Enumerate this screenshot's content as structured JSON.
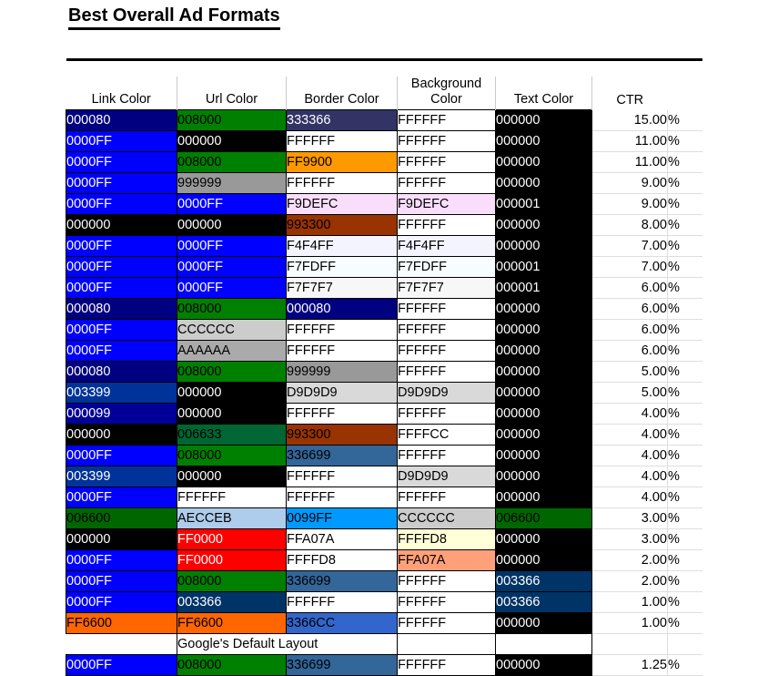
{
  "page": {
    "title": "Best Overall Ad Formats"
  },
  "table": {
    "columns": [
      {
        "key": "link",
        "label": "Link Color"
      },
      {
        "key": "url",
        "label": "Url Color"
      },
      {
        "key": "border",
        "label": "Border Color"
      },
      {
        "key": "bg",
        "label": "Background Color",
        "label_line1": "Background",
        "label_line2": "Color"
      },
      {
        "key": "text",
        "label": "Text Color"
      },
      {
        "key": "ctr",
        "label": "CTR"
      },
      {
        "key": "pct",
        "label": ""
      }
    ],
    "percent_symbol": "%",
    "note_row_label": "Google's Default Layout",
    "rows": [
      {
        "link": "000080",
        "link_bg": "#000080",
        "link_fg": "#ffffff",
        "url": "008000",
        "url_bg": "#008000",
        "url_fg": "#000000",
        "border": "333366",
        "border_bg": "#333366",
        "border_fg": "#ffffff",
        "bg": "FFFFFF",
        "bg_bg": "#ffffff",
        "bg_fg": "#000000",
        "text": "000000",
        "text_bg": "#000000",
        "text_fg": "#ffffff",
        "ctr": "15.00"
      },
      {
        "link": "0000FF",
        "link_bg": "#0000ff",
        "link_fg": "#ffffff",
        "url": "000000",
        "url_bg": "#000000",
        "url_fg": "#ffffff",
        "border": "FFFFFF",
        "border_bg": "#ffffff",
        "border_fg": "#000000",
        "bg": "FFFFFF",
        "bg_bg": "#ffffff",
        "bg_fg": "#000000",
        "text": "000000",
        "text_bg": "#000000",
        "text_fg": "#ffffff",
        "ctr": "11.00"
      },
      {
        "link": "0000FF",
        "link_bg": "#0000ff",
        "link_fg": "#ffffff",
        "url": "008000",
        "url_bg": "#008000",
        "url_fg": "#000000",
        "border": "FF9900",
        "border_bg": "#ff9900",
        "border_fg": "#000000",
        "bg": "FFFFFF",
        "bg_bg": "#ffffff",
        "bg_fg": "#000000",
        "text": "000000",
        "text_bg": "#000000",
        "text_fg": "#ffffff",
        "ctr": "11.00"
      },
      {
        "link": "0000FF",
        "link_bg": "#0000ff",
        "link_fg": "#ffffff",
        "url": "999999",
        "url_bg": "#999999",
        "url_fg": "#000000",
        "border": "FFFFFF",
        "border_bg": "#ffffff",
        "border_fg": "#000000",
        "bg": "FFFFFF",
        "bg_bg": "#ffffff",
        "bg_fg": "#000000",
        "text": "000000",
        "text_bg": "#000000",
        "text_fg": "#ffffff",
        "ctr": "9.00"
      },
      {
        "link": "0000FF",
        "link_bg": "#0000ff",
        "link_fg": "#ffffff",
        "url": "0000FF",
        "url_bg": "#0000ff",
        "url_fg": "#ffffff",
        "border": "F9DEFC",
        "border_bg": "#f9defc",
        "border_fg": "#000000",
        "bg": "F9DEFC",
        "bg_bg": "#f9defc",
        "bg_fg": "#000000",
        "text": "000001",
        "text_bg": "#000001",
        "text_fg": "#ffffff",
        "ctr": "9.00"
      },
      {
        "link": "000000",
        "link_bg": "#000000",
        "link_fg": "#ffffff",
        "url": "000000",
        "url_bg": "#000000",
        "url_fg": "#ffffff",
        "border": "993300",
        "border_bg": "#993300",
        "border_fg": "#000000",
        "bg": "FFFFFF",
        "bg_bg": "#ffffff",
        "bg_fg": "#000000",
        "text": "000000",
        "text_bg": "#000000",
        "text_fg": "#ffffff",
        "ctr": "8.00"
      },
      {
        "link": "0000FF",
        "link_bg": "#0000ff",
        "link_fg": "#ffffff",
        "url": "0000FF",
        "url_bg": "#0000ff",
        "url_fg": "#ffffff",
        "border": "F4F4FF",
        "border_bg": "#f4f4ff",
        "border_fg": "#000000",
        "bg": "F4F4FF",
        "bg_bg": "#f4f4ff",
        "bg_fg": "#000000",
        "text": "000000",
        "text_bg": "#000000",
        "text_fg": "#ffffff",
        "ctr": "7.00"
      },
      {
        "link": "0000FF",
        "link_bg": "#0000ff",
        "link_fg": "#ffffff",
        "url": "0000FF",
        "url_bg": "#0000ff",
        "url_fg": "#ffffff",
        "border": "F7FDFF",
        "border_bg": "#f7fdff",
        "border_fg": "#000000",
        "bg": "F7FDFF",
        "bg_bg": "#f7fdff",
        "bg_fg": "#000000",
        "text": "000001",
        "text_bg": "#000001",
        "text_fg": "#ffffff",
        "ctr": "7.00"
      },
      {
        "link": "0000FF",
        "link_bg": "#0000ff",
        "link_fg": "#ffffff",
        "url": "0000FF",
        "url_bg": "#0000ff",
        "url_fg": "#ffffff",
        "border": "F7F7F7",
        "border_bg": "#f7f7f7",
        "border_fg": "#000000",
        "bg": "F7F7F7",
        "bg_bg": "#f7f7f7",
        "bg_fg": "#000000",
        "text": "000001",
        "text_bg": "#000001",
        "text_fg": "#ffffff",
        "ctr": "6.00"
      },
      {
        "link": "000080",
        "link_bg": "#000080",
        "link_fg": "#ffffff",
        "url": "008000",
        "url_bg": "#008000",
        "url_fg": "#000000",
        "border": "000080",
        "border_bg": "#000080",
        "border_fg": "#ffffff",
        "bg": "FFFFFF",
        "bg_bg": "#ffffff",
        "bg_fg": "#000000",
        "text": "000000",
        "text_bg": "#000000",
        "text_fg": "#ffffff",
        "ctr": "6.00"
      },
      {
        "link": "0000FF",
        "link_bg": "#0000ff",
        "link_fg": "#ffffff",
        "url": "CCCCCC",
        "url_bg": "#cccccc",
        "url_fg": "#000000",
        "border": "FFFFFF",
        "border_bg": "#ffffff",
        "border_fg": "#000000",
        "bg": "FFFFFF",
        "bg_bg": "#ffffff",
        "bg_fg": "#000000",
        "text": "000000",
        "text_bg": "#000000",
        "text_fg": "#ffffff",
        "ctr": "6.00"
      },
      {
        "link": "0000FF",
        "link_bg": "#0000ff",
        "link_fg": "#ffffff",
        "url": "AAAAAA",
        "url_bg": "#aaaaaa",
        "url_fg": "#000000",
        "border": "FFFFFF",
        "border_bg": "#ffffff",
        "border_fg": "#000000",
        "bg": "FFFFFF",
        "bg_bg": "#ffffff",
        "bg_fg": "#000000",
        "text": "000000",
        "text_bg": "#000000",
        "text_fg": "#ffffff",
        "ctr": "6.00"
      },
      {
        "link": "000080",
        "link_bg": "#000080",
        "link_fg": "#ffffff",
        "url": "008000",
        "url_bg": "#008000",
        "url_fg": "#000000",
        "border": "999999",
        "border_bg": "#999999",
        "border_fg": "#000000",
        "bg": "FFFFFF",
        "bg_bg": "#ffffff",
        "bg_fg": "#000000",
        "text": "000000",
        "text_bg": "#000000",
        "text_fg": "#ffffff",
        "ctr": "5.00"
      },
      {
        "link": "003399",
        "link_bg": "#003399",
        "link_fg": "#ffffff",
        "url": "000000",
        "url_bg": "#000000",
        "url_fg": "#ffffff",
        "border": "D9D9D9",
        "border_bg": "#d9d9d9",
        "border_fg": "#000000",
        "bg": "D9D9D9",
        "bg_bg": "#d9d9d9",
        "bg_fg": "#000000",
        "text": "000000",
        "text_bg": "#000000",
        "text_fg": "#ffffff",
        "ctr": "5.00"
      },
      {
        "link": "000099",
        "link_bg": "#000099",
        "link_fg": "#ffffff",
        "url": "000000",
        "url_bg": "#000000",
        "url_fg": "#ffffff",
        "border": "FFFFFF",
        "border_bg": "#ffffff",
        "border_fg": "#000000",
        "bg": "FFFFFF",
        "bg_bg": "#ffffff",
        "bg_fg": "#000000",
        "text": "000000",
        "text_bg": "#000000",
        "text_fg": "#ffffff",
        "ctr": "4.00"
      },
      {
        "link": "000000",
        "link_bg": "#000000",
        "link_fg": "#ffffff",
        "url": "006633",
        "url_bg": "#006633",
        "url_fg": "#000000",
        "border": "993300",
        "border_bg": "#993300",
        "border_fg": "#000000",
        "bg": "FFFFCC",
        "bg_bg": "#ffffff",
        "bg_fg": "#000000",
        "text": "000000",
        "text_bg": "#000000",
        "text_fg": "#ffffff",
        "ctr": "4.00"
      },
      {
        "link": "0000FF",
        "link_bg": "#0000ff",
        "link_fg": "#ffffff",
        "url": "008000",
        "url_bg": "#008000",
        "url_fg": "#000000",
        "border": "336699",
        "border_bg": "#336699",
        "border_fg": "#000000",
        "bg": "FFFFFF",
        "bg_bg": "#ffffff",
        "bg_fg": "#000000",
        "text": "000000",
        "text_bg": "#000000",
        "text_fg": "#ffffff",
        "ctr": "4.00"
      },
      {
        "link": "003399",
        "link_bg": "#003399",
        "link_fg": "#ffffff",
        "url": "000000",
        "url_bg": "#000000",
        "url_fg": "#ffffff",
        "border": "FFFFFF",
        "border_bg": "#ffffff",
        "border_fg": "#000000",
        "bg": "D9D9D9",
        "bg_bg": "#d9d9d9",
        "bg_fg": "#000000",
        "text": "000000",
        "text_bg": "#000000",
        "text_fg": "#ffffff",
        "ctr": "4.00"
      },
      {
        "link": "0000FF",
        "link_bg": "#0000ff",
        "link_fg": "#ffffff",
        "url": "FFFFFF",
        "url_bg": "#ffffff",
        "url_fg": "#000000",
        "border": "FFFFFF",
        "border_bg": "#ffffff",
        "border_fg": "#000000",
        "bg": "FFFFFF",
        "bg_bg": "#ffffff",
        "bg_fg": "#000000",
        "text": "000000",
        "text_bg": "#000000",
        "text_fg": "#ffffff",
        "ctr": "4.00"
      },
      {
        "link": "006600",
        "link_bg": "#006600",
        "link_fg": "#000000",
        "url": "AECCEB",
        "url_bg": "#aecceb",
        "url_fg": "#000000",
        "border": "0099FF",
        "border_bg": "#0099ff",
        "border_fg": "#000000",
        "bg": "CCCCCC",
        "bg_bg": "#cccccc",
        "bg_fg": "#000000",
        "text": "006600",
        "text_bg": "#006600",
        "text_fg": "#000000",
        "ctr": "3.00"
      },
      {
        "link": "000000",
        "link_bg": "#000000",
        "link_fg": "#ffffff",
        "url": "FF0000",
        "url_bg": "#ff0000",
        "url_fg": "#ffffff",
        "border": "FFA07A",
        "border_bg": "#ffffff",
        "border_fg": "#000000",
        "bg": "FFFFD8",
        "bg_bg": "#ffffd8",
        "bg_fg": "#000000",
        "text": "000000",
        "text_bg": "#000000",
        "text_fg": "#ffffff",
        "ctr": "3.00"
      },
      {
        "link": "0000FF",
        "link_bg": "#0000ff",
        "link_fg": "#ffffff",
        "url": "FF0000",
        "url_bg": "#ff0000",
        "url_fg": "#ffffff",
        "border": "FFFFD8",
        "border_bg": "#ffffff",
        "border_fg": "#000000",
        "bg": "FFA07A",
        "bg_bg": "#ffa07a",
        "bg_fg": "#000000",
        "text": "000000",
        "text_bg": "#000000",
        "text_fg": "#ffffff",
        "ctr": "2.00"
      },
      {
        "link": "0000FF",
        "link_bg": "#0000ff",
        "link_fg": "#ffffff",
        "url": "008000",
        "url_bg": "#008000",
        "url_fg": "#000000",
        "border": "336699",
        "border_bg": "#336699",
        "border_fg": "#000000",
        "bg": "FFFFFF",
        "bg_bg": "#ffffff",
        "bg_fg": "#000000",
        "text": "003366",
        "text_bg": "#003366",
        "text_fg": "#ffffff",
        "ctr": "2.00"
      },
      {
        "link": "0000FF",
        "link_bg": "#0000ff",
        "link_fg": "#ffffff",
        "url": "003366",
        "url_bg": "#003366",
        "url_fg": "#ffffff",
        "border": "FFFFFF",
        "border_bg": "#ffffff",
        "border_fg": "#000000",
        "bg": "FFFFFF",
        "bg_bg": "#ffffff",
        "bg_fg": "#000000",
        "text": "003366",
        "text_bg": "#003366",
        "text_fg": "#ffffff",
        "ctr": "1.00"
      },
      {
        "link": "FF6600",
        "link_bg": "#ff6600",
        "link_fg": "#000000",
        "url": "FF6600",
        "url_bg": "#ff6600",
        "url_fg": "#000000",
        "border": "3366CC",
        "border_bg": "#3366cc",
        "border_fg": "#000000",
        "bg": "FFFFFF",
        "bg_bg": "#ffffff",
        "bg_fg": "#000000",
        "text": "000000",
        "text_bg": "#000000",
        "text_fg": "#ffffff",
        "ctr": "1.00"
      }
    ],
    "default_row": {
      "link": "0000FF",
      "link_bg": "#0000ff",
      "link_fg": "#ffffff",
      "url": "008000",
      "url_bg": "#008000",
      "url_fg": "#000000",
      "border": "336699",
      "border_bg": "#336699",
      "border_fg": "#000000",
      "bg": "FFFFFF",
      "bg_bg": "#ffffff",
      "bg_fg": "#000000",
      "text": "000000",
      "text_bg": "#000000",
      "text_fg": "#ffffff",
      "ctr": "1.25"
    }
  }
}
